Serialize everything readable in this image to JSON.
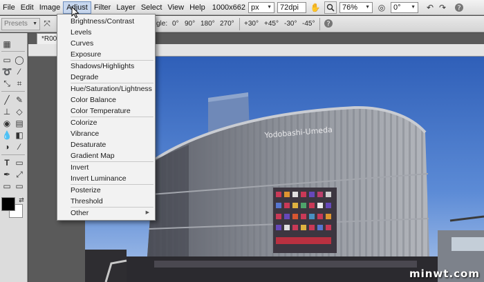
{
  "menubar": {
    "items": [
      "File",
      "Edit",
      "Image",
      "Adjust",
      "Filter",
      "Layer",
      "Select",
      "View",
      "Help"
    ],
    "active_index": 3,
    "image_size": "1000x662",
    "unit": "px",
    "resolution": "72dpi",
    "zoom": "76%",
    "angle": "0°"
  },
  "optionsbar": {
    "presets_label": "Presets",
    "angle_label": "gle:",
    "angles": [
      "0°",
      "90°",
      "180°",
      "270°"
    ],
    "nudges": [
      "+30°",
      "+45°",
      "-30°",
      "-45°"
    ]
  },
  "document": {
    "tab_label": "*R00"
  },
  "adjust_menu": {
    "groups": [
      [
        "Brightness/Contrast",
        "Levels",
        "Curves",
        "Exposure"
      ],
      [
        "Shadows/Highlights",
        "Degrade"
      ],
      [
        "Hue/Saturation/Lightness",
        "Color Balance",
        "Color Temperature"
      ],
      [
        "Colorize",
        "Vibrance",
        "Desaturate",
        "Gradient Map"
      ],
      [
        "Invert",
        "Invert Luminance"
      ],
      [
        "Posterize",
        "Threshold"
      ],
      [
        "Other"
      ]
    ]
  },
  "photo": {
    "sign_text": "Yodobashi-Umeda"
  },
  "watermark": "minwt.com",
  "colors": {
    "menu_active_bg": "#c7d7ee",
    "sky": "#3f6fc2",
    "building": "#8a8c92"
  }
}
